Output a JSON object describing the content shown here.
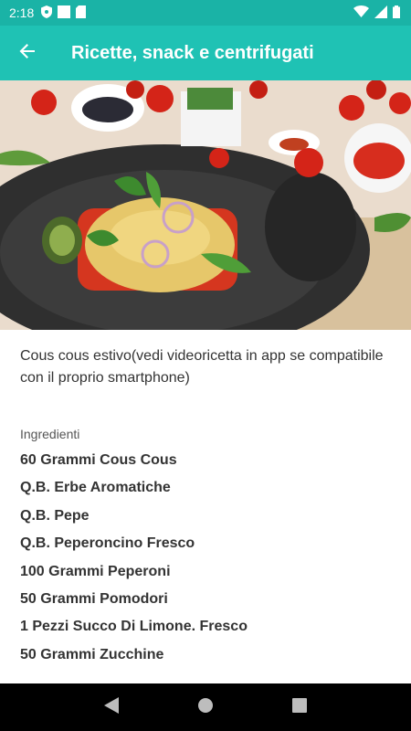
{
  "status": {
    "time": "2:18",
    "icons": [
      "shield-icon",
      "square-icon",
      "sd-card-icon",
      "wifi-icon",
      "signal-icon",
      "battery-icon"
    ]
  },
  "app_bar": {
    "title": "Ricette, snack e centrifugati",
    "background": "#1fc2b4",
    "status_background": "#1ab3a6"
  },
  "recipe": {
    "title": "Cous cous estivo(vedi videoricetta in app se compatibile con il proprio smartphone)",
    "ingredients_label": "Ingredienti",
    "ingredients": [
      "60 Grammi Cous Cous",
      "Q.B. Erbe Aromatiche",
      "Q.B. Pepe",
      "Q.B. Peperoncino Fresco",
      "100 Grammi Peperoni",
      "50 Grammi Pomodori",
      "1 Pezzi Succo Di Limone. Fresco",
      "50 Grammi Zucchine"
    ]
  },
  "nav": {
    "icons": [
      "back-triangle-icon",
      "home-circle-icon",
      "recents-square-icon"
    ]
  }
}
